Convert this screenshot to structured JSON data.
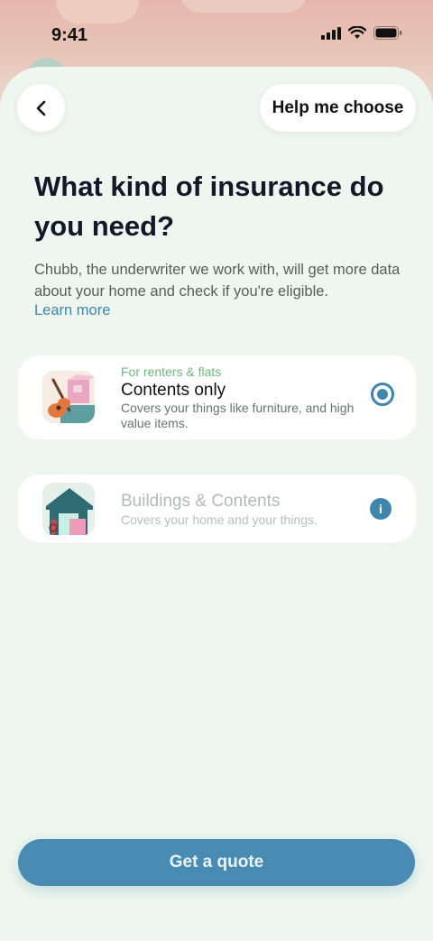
{
  "status_bar": {
    "time": "9:41",
    "icons": [
      "cellular-signal-icon",
      "wifi-icon",
      "battery-icon"
    ]
  },
  "header": {
    "back_icon": "chevron-left-icon",
    "help_label": "Help me choose"
  },
  "main": {
    "title": "What kind of insurance do you need?",
    "description": "Chubb, the underwriter we work with, will get more data about your home and check if you're eligible.",
    "learn_more": "Learn more"
  },
  "options": [
    {
      "tag": "For renters & flats",
      "title": "Contents only",
      "subtitle": "Covers your things like furniture, and high value items.",
      "selected": true,
      "icon": "guitar-and-boxes-illustration"
    },
    {
      "title": "Buildings & Contents",
      "subtitle": "Covers your home and your things.",
      "selected": false,
      "disabled": true,
      "info_icon": "info-icon",
      "icon": "house-illustration"
    }
  ],
  "footer": {
    "cta_label": "Get a quote"
  },
  "colors": {
    "accent": "#3f86ad",
    "tag_green": "#72b57e",
    "background": "#eef6ef",
    "button": "#4a8bb4"
  }
}
